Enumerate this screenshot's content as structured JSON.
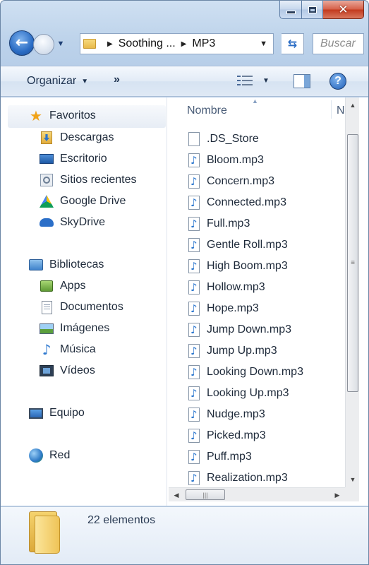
{
  "window": {
    "caption": {
      "minimize": "",
      "maximize": "",
      "close": "✕"
    }
  },
  "navigation": {
    "breadcrumbs": [
      "Soothing ...",
      "MP3"
    ],
    "search_placeholder": "Buscar"
  },
  "toolbar": {
    "organize_label": "Organizar",
    "more_label": "»"
  },
  "sidebar": {
    "favorites": {
      "label": "Favoritos",
      "items": [
        {
          "label": "Descargas",
          "icon": "downloads-icon"
        },
        {
          "label": "Escritorio",
          "icon": "desktop-icon"
        },
        {
          "label": "Sitios recientes",
          "icon": "recent-places-icon"
        },
        {
          "label": "Google Drive",
          "icon": "google-drive-icon"
        },
        {
          "label": "SkyDrive",
          "icon": "skydrive-icon"
        }
      ]
    },
    "libraries": {
      "label": "Bibliotecas",
      "items": [
        {
          "label": "Apps",
          "icon": "apps-icon"
        },
        {
          "label": "Documentos",
          "icon": "documents-icon"
        },
        {
          "label": "Imágenes",
          "icon": "pictures-icon"
        },
        {
          "label": "Música",
          "icon": "music-icon"
        },
        {
          "label": "Vídeos",
          "icon": "videos-icon"
        }
      ]
    },
    "computer": {
      "label": "Equipo"
    },
    "network": {
      "label": "Red"
    }
  },
  "file_list": {
    "columns": {
      "name": "Nombre",
      "next_truncated": "N"
    },
    "files": [
      ".DS_Store",
      "Bloom.mp3",
      "Concern.mp3",
      "Connected.mp3",
      "Full.mp3",
      "Gentle Roll.mp3",
      "High Boom.mp3",
      "Hollow.mp3",
      "Hope.mp3",
      "Jump Down.mp3",
      "Jump Up.mp3",
      "Looking Down.mp3",
      "Looking Up.mp3",
      "Nudge.mp3",
      "Picked.mp3",
      "Puff.mp3",
      "Realization.mp3"
    ]
  },
  "details": {
    "item_count": "22 elementos"
  },
  "colors": {
    "accent": "#2a6cc4",
    "close": "#c23a1e",
    "folder": "#e7b846"
  }
}
